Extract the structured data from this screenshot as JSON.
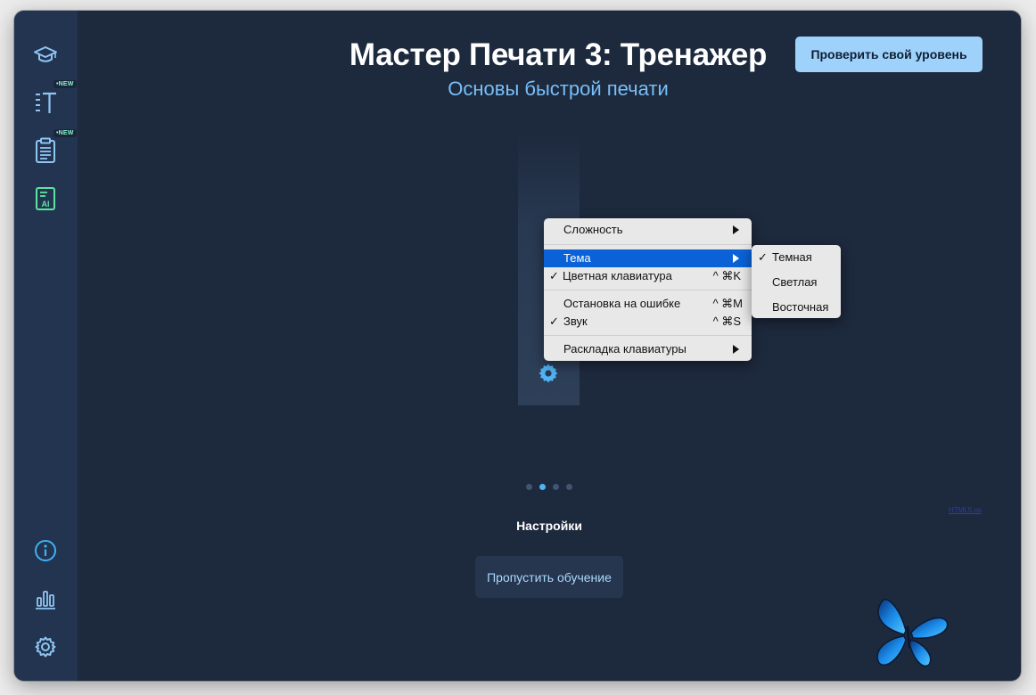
{
  "app": {
    "title": "Мастер Печати 3: Тренажер",
    "subtitle": "Основы быстрой печати",
    "check_level_button": "Проверить свой уровень"
  },
  "sidebar": {
    "items": [
      {
        "icon": "graduation-cap-icon",
        "badge": ""
      },
      {
        "icon": "text-type-icon",
        "badge": "•NEW"
      },
      {
        "icon": "clipboard-icon",
        "badge": "•NEW"
      },
      {
        "icon": "ai-document-icon",
        "badge": ""
      }
    ],
    "bottom": [
      {
        "icon": "info-icon"
      },
      {
        "icon": "stats-chart-icon"
      },
      {
        "icon": "settings-gear-icon"
      }
    ]
  },
  "context_menu": {
    "items": [
      {
        "label": "Сложность",
        "submenu": true
      },
      {
        "label": "Тема",
        "submenu": true,
        "highlighted": true
      },
      {
        "label": "Цветная клавиатура",
        "checked": true,
        "shortcut": "^ ⌘K"
      },
      {
        "label": "Остановка на ошибке",
        "shortcut": "^ ⌘M"
      },
      {
        "label": "Звук",
        "checked": true,
        "shortcut": "^ ⌘S"
      },
      {
        "label": "Раскладка клавиатуры",
        "submenu": true
      }
    ],
    "check_mark": "✓"
  },
  "theme_submenu": {
    "items": [
      {
        "label": "Темная",
        "checked": true
      },
      {
        "label": "Светлая"
      },
      {
        "label": "Восточная"
      }
    ]
  },
  "pager": {
    "total": 4,
    "active": 2
  },
  "caption": "Настройки",
  "skip_button": "Пропустить обучение",
  "tiny_link": "HTML5.us",
  "colors": {
    "background": "#1d293d",
    "sidebar": "#223450",
    "accent": "#79bff8",
    "menu_highlight": "#0a62d6",
    "new_badge": "#8cf2d0"
  }
}
